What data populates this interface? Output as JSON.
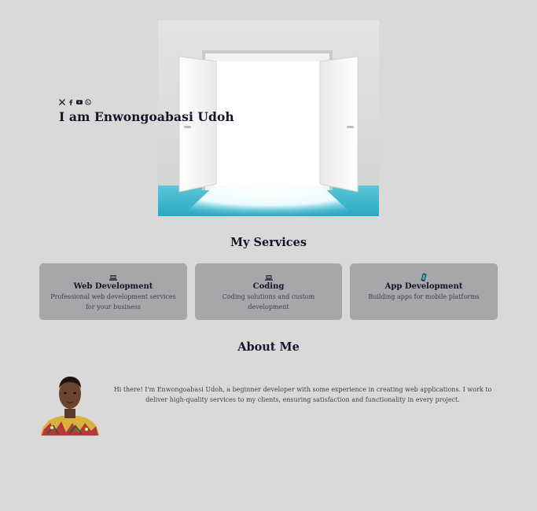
{
  "hero": {
    "name": "I am Enwongoabasi Udoh",
    "image": "open-door-illustration",
    "socials": [
      "x-icon",
      "facebook-icon",
      "youtube-icon",
      "whatsapp-icon"
    ]
  },
  "services": {
    "title": "My Services",
    "items": [
      {
        "icon": "laptop-icon",
        "title": "Web Development",
        "description": "Professional web development services for your business"
      },
      {
        "icon": "laptop-icon",
        "title": "Coding",
        "description": "Coding solutions and custom development"
      },
      {
        "icon": "mobile-phone-icon",
        "title": "App Development",
        "description": "Building apps for mobile platforms"
      }
    ]
  },
  "about": {
    "title": "About Me",
    "text": "Hi there! I'm Enwongoabasi Udoh, a beginner developer with some experience in creating web applications. I work to deliver high-quality services to my clients, ensuring satisfaction and functionality in every project."
  },
  "colors": {
    "background": "#d9d9d9",
    "card": "#a7a6a9",
    "heading": "#14142b",
    "floor": "#2fb1c9"
  }
}
